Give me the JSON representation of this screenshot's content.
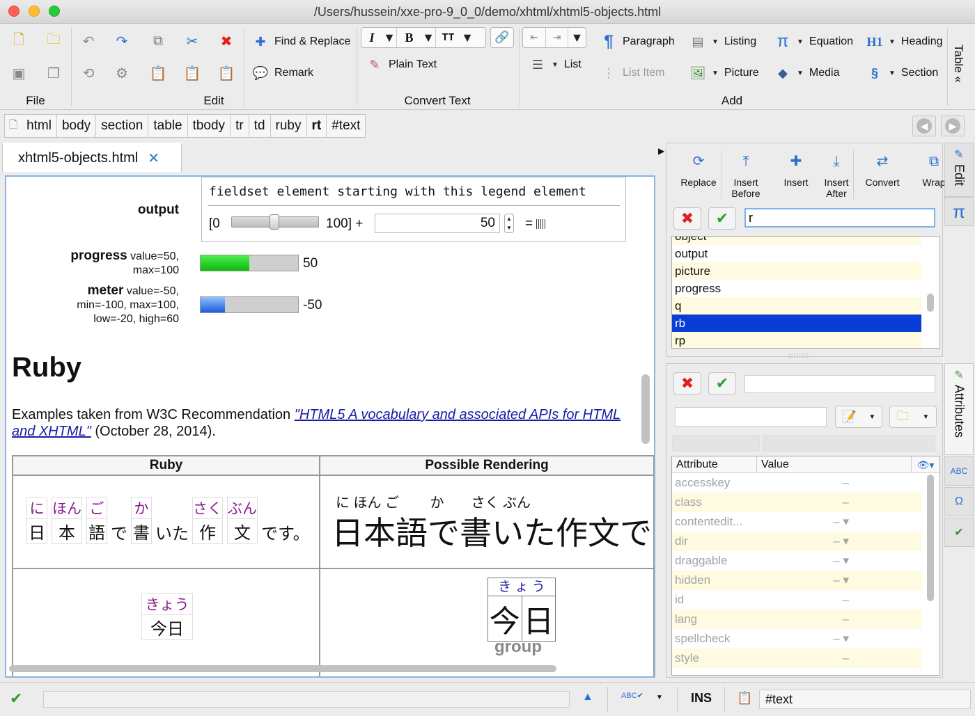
{
  "window": {
    "title": "/Users/hussein/xxe-pro-9_0_0/demo/xhtml/xhtml5-objects.html"
  },
  "ribbon": {
    "groups": {
      "file": "File",
      "edit": "Edit",
      "convert": "Convert Text",
      "add": "Add"
    },
    "find_replace": "Find & Replace",
    "remark": "Remark",
    "plain_text": "Plain Text",
    "italic": "I",
    "bold": "B",
    "tt": "TT",
    "list": "List",
    "list_item": "List Item",
    "paragraph": "Paragraph",
    "listing": "Listing",
    "equation": "Equation",
    "heading": "Heading",
    "picture": "Picture",
    "media": "Media",
    "section": "Section",
    "table_tab": "Table"
  },
  "breadcrumb": [
    "html",
    "body",
    "section",
    "table",
    "tbody",
    "tr",
    "td",
    "ruby",
    "rt",
    "#text"
  ],
  "editor": {
    "tab_label": "xhtml5-objects.html",
    "output_label": "output",
    "fieldset_legend": "fieldset element starting with this legend element",
    "range_open": "[0",
    "range_close": "100] +",
    "number_value": "50",
    "equals": "=",
    "progress_label": "progress",
    "progress_attrs_1": "value=50,",
    "progress_attrs_2": "max=100",
    "progress_value": 0.5,
    "progress_text": "50",
    "meter_label": "meter",
    "meter_attrs_1": "value=-50,",
    "meter_attrs_2": "min=-100, max=100,",
    "meter_attrs_3": "low=-20, high=60",
    "meter_value": 0.25,
    "meter_text": "-50",
    "heading": "Ruby",
    "intro_text": "Examples taken from W3C Recommendation ",
    "intro_link": "\"HTML5 A vocabulary and associated APIs for HTML and XHTML\"",
    "intro_tail": " (October 28, 2014).",
    "table_headers": [
      "Ruby",
      "Possible Rendering"
    ],
    "row1_ruby": [
      {
        "base": "日",
        "rt": "に"
      },
      {
        "base": "本",
        "rt": "ほん"
      },
      {
        "base": "語",
        "rt": "ご"
      },
      {
        "plain": "で"
      },
      {
        "base": "書",
        "rt": "か"
      },
      {
        "plain": "いた"
      },
      {
        "base": "作",
        "rt": "さく"
      },
      {
        "base": "文",
        "rt": "ぶん"
      },
      {
        "plain": "です。"
      }
    ],
    "row1_render_rt": "に ほん ご        か       さく ぶん",
    "row1_render_base": "日本語で書いた作文で",
    "row2_rt": "きょう",
    "row2_base": "今日",
    "row2_render_rt": "き ょ う",
    "row2_render_base_1": "今",
    "row2_render_base_2": "日",
    "row2_caption": "group"
  },
  "right_panel": {
    "actions": [
      "Replace",
      "Insert Before",
      "Insert",
      "Insert After",
      "Convert",
      "Wrap"
    ],
    "search_value": "r",
    "element_list": [
      "object",
      "output",
      "picture",
      "progress",
      "q",
      "rb",
      "rp"
    ],
    "selected_element": "rb",
    "attr_headers": {
      "name": "Attribute",
      "value": "Value"
    },
    "attributes": [
      {
        "name": "accesskey",
        "value": "–"
      },
      {
        "name": "class",
        "value": "–"
      },
      {
        "name": "contentedit...",
        "value": "– ▾"
      },
      {
        "name": "dir",
        "value": "– ▾"
      },
      {
        "name": "draggable",
        "value": "– ▾"
      },
      {
        "name": "hidden",
        "value": "– ▾"
      },
      {
        "name": "id",
        "value": "–"
      },
      {
        "name": "lang",
        "value": "–"
      },
      {
        "name": "spellcheck",
        "value": "– ▾"
      },
      {
        "name": "style",
        "value": "–"
      }
    ],
    "side_tabs": {
      "edit": "Edit",
      "attributes": "Attributes"
    }
  },
  "status": {
    "ins": "INS",
    "node": "#text"
  },
  "colors": {
    "selection": "#0a3cd6",
    "zebra": "#fffbe0",
    "link": "#1a1aa6",
    "ruby_text": "#8a1a8a"
  }
}
